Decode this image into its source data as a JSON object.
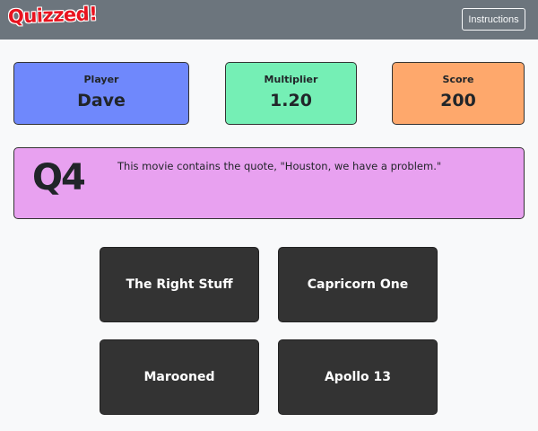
{
  "navbar": {
    "brand": "Quizzed!",
    "instructions_label": "Instructions"
  },
  "stats": {
    "player_label": "Player",
    "player_value": "Dave",
    "multiplier_label": "Multiplier",
    "multiplier_value": "1.20",
    "score_label": "Score",
    "score_value": "200"
  },
  "question": {
    "number": "Q4",
    "text": "This movie contains the quote, \"Houston, we have a problem.\""
  },
  "answers": [
    "The Right Stuff",
    "Capricorn One",
    "Marooned",
    "Apollo 13"
  ],
  "colors": {
    "navbar": "#6c757d",
    "brand": "#e8131f",
    "player_card": "#6f88fc",
    "multiplier_card": "#75efb5",
    "score_card": "#fea86c",
    "question_box": "#e8a1f0",
    "answer_button": "#333333"
  }
}
